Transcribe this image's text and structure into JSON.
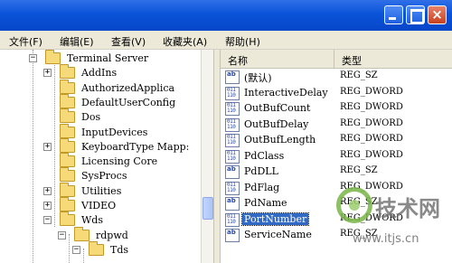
{
  "window": {
    "title_buttons": {
      "minimize": "minimize-icon",
      "maximize": "maximize-icon",
      "close": "×"
    }
  },
  "menu": [
    {
      "label": "文件(F)"
    },
    {
      "label": "编辑(E)"
    },
    {
      "label": "查看(V)"
    },
    {
      "label": "收藏夹(A)"
    },
    {
      "label": "帮助(H)"
    }
  ],
  "tree": {
    "items": [
      {
        "label": "Terminal Server",
        "expander": "−"
      },
      {
        "label": "AddIns",
        "expander": "+"
      },
      {
        "label": "AuthorizedApplica",
        "expander": ""
      },
      {
        "label": "DefaultUserConfig",
        "expander": ""
      },
      {
        "label": "Dos",
        "expander": ""
      },
      {
        "label": "InputDevices",
        "expander": ""
      },
      {
        "label": "KeyboardType Mapp:",
        "expander": "+"
      },
      {
        "label": "Licensing Core",
        "expander": ""
      },
      {
        "label": "SysProcs",
        "expander": ""
      },
      {
        "label": "Utilities",
        "expander": "+"
      },
      {
        "label": "VIDEO",
        "expander": "+"
      },
      {
        "label": "Wds",
        "expander": "−"
      },
      {
        "label": "rdpwd",
        "expander": "−"
      },
      {
        "label": "Tds",
        "expander": "−"
      }
    ]
  },
  "list": {
    "columns": {
      "name": "名称",
      "type": "类型"
    },
    "rows": [
      {
        "icon": "string-value-icon",
        "glyph": "ab",
        "name": "(默认)",
        "type": "REG_SZ"
      },
      {
        "icon": "binary-value-icon",
        "glyph": "011\n110",
        "name": "InteractiveDelay",
        "type": "REG_DWORD"
      },
      {
        "icon": "binary-value-icon",
        "glyph": "011\n110",
        "name": "OutBufCount",
        "type": "REG_DWORD"
      },
      {
        "icon": "binary-value-icon",
        "glyph": "011\n110",
        "name": "OutBufDelay",
        "type": "REG_DWORD"
      },
      {
        "icon": "binary-value-icon",
        "glyph": "011\n110",
        "name": "OutBufLength",
        "type": "REG_DWORD"
      },
      {
        "icon": "binary-value-icon",
        "glyph": "011\n110",
        "name": "PdClass",
        "type": "REG_DWORD"
      },
      {
        "icon": "string-value-icon",
        "glyph": "ab",
        "name": "PdDLL",
        "type": "REG_SZ"
      },
      {
        "icon": "binary-value-icon",
        "glyph": "011\n110",
        "name": "PdFlag",
        "type": "REG_DWORD"
      },
      {
        "icon": "string-value-icon",
        "glyph": "ab",
        "name": "PdName",
        "type": "REG_SZ"
      },
      {
        "icon": "binary-value-icon",
        "glyph": "011\n110",
        "name": "PortNumber",
        "type": "REG_DWORD",
        "selected": true
      },
      {
        "icon": "string-value-icon",
        "glyph": "ab",
        "name": "ServiceName",
        "type": "REG_SZ"
      }
    ]
  },
  "watermark": {
    "brand": "技术网",
    "url": "www.itjs.cn",
    "accent": "#7ab648"
  }
}
